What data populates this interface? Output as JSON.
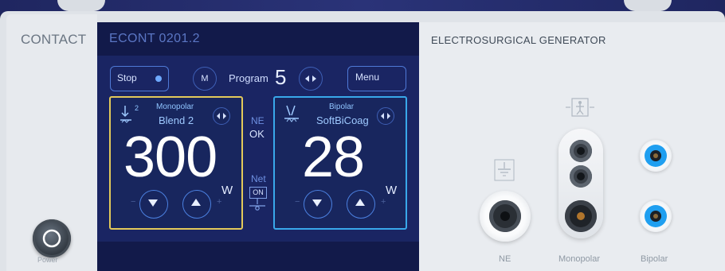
{
  "device": {
    "brand": "CONTACT",
    "power_label": "Power"
  },
  "screen": {
    "title": "ECONT 0201.2",
    "stop_label": "Stop",
    "m_label": "M",
    "program_label": "Program",
    "program_number": "5",
    "menu_label": "Menu",
    "ne_label": "NE",
    "ne_status": "OK",
    "net_label": "Net",
    "net_status": "ON",
    "monopolar": {
      "mode": "Monopolar",
      "submode": "Blend 2",
      "value": "300",
      "unit": "W",
      "level_index": "2"
    },
    "bipolar": {
      "mode": "Bipolar",
      "submode": "SoftBiCoag",
      "value": "28",
      "unit": "W"
    }
  },
  "connectors": {
    "title": "ELECTROSURGICAL GENERATOR",
    "labels": [
      "NE",
      "Monopolar",
      "Bipolar"
    ]
  },
  "colors": {
    "monopolar_border": "#e3c95a",
    "bipolar_border": "#39a8ea",
    "screen_bg": "#121a4a",
    "bipolar_jack": "#1f9ff0"
  }
}
